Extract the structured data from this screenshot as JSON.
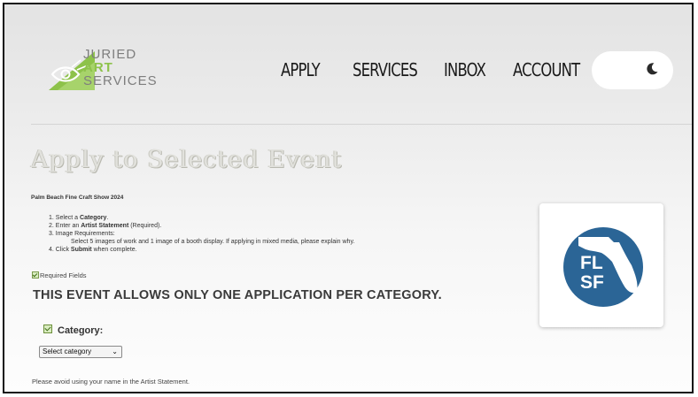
{
  "brand": {
    "line1": "JURIED",
    "line2": "ART",
    "line3": "SERVICES",
    "accent_color": "#8dc24a"
  },
  "nav": {
    "items": [
      {
        "label": "APPLY"
      },
      {
        "label": "SERVICES"
      },
      {
        "label": "INBOX"
      },
      {
        "label": "ACCOUNT"
      }
    ]
  },
  "theme_toggle": {
    "icon": "moon-icon"
  },
  "page": {
    "title": "Apply to Selected Event",
    "event_name": "Palm Beach Fine Craft Show 2024"
  },
  "instructions": {
    "step1_prefix": "1. Select a ",
    "step1_bold": "Category",
    "step1_suffix": ".",
    "step2_prefix": "2. Enter an ",
    "step2_bold": "Artist Statement",
    "step2_suffix": " (Required).",
    "step3": "3. Image Requirements:",
    "step3_detail": "Select 5 images of work and 1 image of a booth display. If applying in mixed media, please explain why.",
    "step4_prefix": "4. Click ",
    "step4_bold": "Submit",
    "step4_suffix": " when complete."
  },
  "required_fields_label": "Required Fields",
  "alert": "THIS EVENT ALLOWS ONLY ONE APPLICATION PER CATEGORY.",
  "category": {
    "label": "Category:",
    "selected": "Select category"
  },
  "note": "Please avoid using your name in the Artist Statement.",
  "event_logo": {
    "line1": "FL",
    "line2": "SF",
    "circle_color": "#2b6596"
  }
}
